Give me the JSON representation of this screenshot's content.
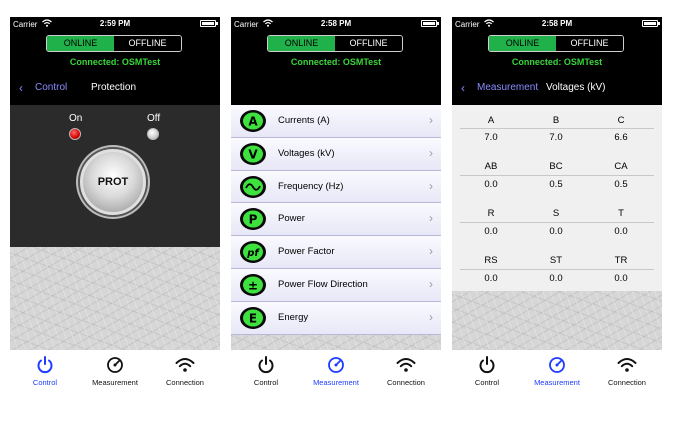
{
  "status": {
    "carrier": "Carrier",
    "time1": "2:59 PM",
    "time2": "2:58 PM",
    "time3": "2:58 PM"
  },
  "header": {
    "online": "ONLINE",
    "offline": "OFFLINE",
    "connected": "Connected: OSMTest"
  },
  "tabs": {
    "control": "Control",
    "measurement": "Measurement",
    "connection": "Connection"
  },
  "screen1": {
    "back": "Control",
    "title": "Protection",
    "on_label": "On",
    "off_label": "Off",
    "prot_button": "PROT"
  },
  "screen2": {
    "items": [
      {
        "icon": "A",
        "label": "Currents (A)"
      },
      {
        "icon": "V",
        "label": "Voltages (kV)"
      },
      {
        "icon": "~",
        "label": "Frequency (Hz)"
      },
      {
        "icon": "P",
        "label": "Power"
      },
      {
        "icon": "pf",
        "label": "Power Factor"
      },
      {
        "icon": "±",
        "label": "Power Flow Direction"
      },
      {
        "icon": "E",
        "label": "Energy"
      }
    ]
  },
  "screen3": {
    "back": "Measurement",
    "title": "Voltages (kV)",
    "rows": [
      {
        "labels": [
          "A",
          "B",
          "C"
        ],
        "values": [
          "7.0",
          "7.0",
          "6.6"
        ]
      },
      {
        "labels": [
          "AB",
          "BC",
          "CA"
        ],
        "values": [
          "0.0",
          "0.5",
          "0.5"
        ]
      },
      {
        "labels": [
          "R",
          "S",
          "T"
        ],
        "values": [
          "0.0",
          "0.0",
          "0.0"
        ]
      },
      {
        "labels": [
          "RS",
          "ST",
          "TR"
        ],
        "values": [
          "0.0",
          "0.0",
          "0.0"
        ]
      }
    ]
  },
  "colors": {
    "online_green": "#21b14b",
    "connected_green": "#39d63a",
    "active_tab": "#1d3cff",
    "nav_link": "#8a8cff"
  }
}
